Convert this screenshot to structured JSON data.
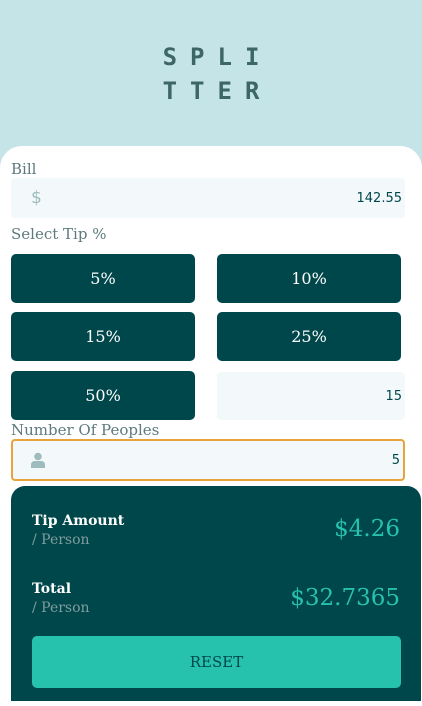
{
  "logo": {
    "line1": "SPLI",
    "line2": "TTER"
  },
  "bill": {
    "label": "Bill",
    "currency_symbol": "$",
    "value": "142.55"
  },
  "tip": {
    "label": "Select Tip %",
    "options": [
      "5%",
      "10%",
      "15%",
      "25%",
      "50%"
    ],
    "custom_value": "15"
  },
  "people": {
    "label": "Number Of Peoples",
    "value": "5",
    "icon": "person-icon"
  },
  "result": {
    "tip_title": "Tip Amount",
    "tip_sub": "/ Person",
    "tip_value": "$4.26",
    "total_title": "Total",
    "total_sub": "/ Person",
    "total_value": "$32.7365",
    "reset_label": "RESET"
  },
  "colors": {
    "background": "#c5e4e7",
    "dark_cyan": "#00474b",
    "accent": "#26c2ad",
    "focus": "#e8a33a"
  }
}
